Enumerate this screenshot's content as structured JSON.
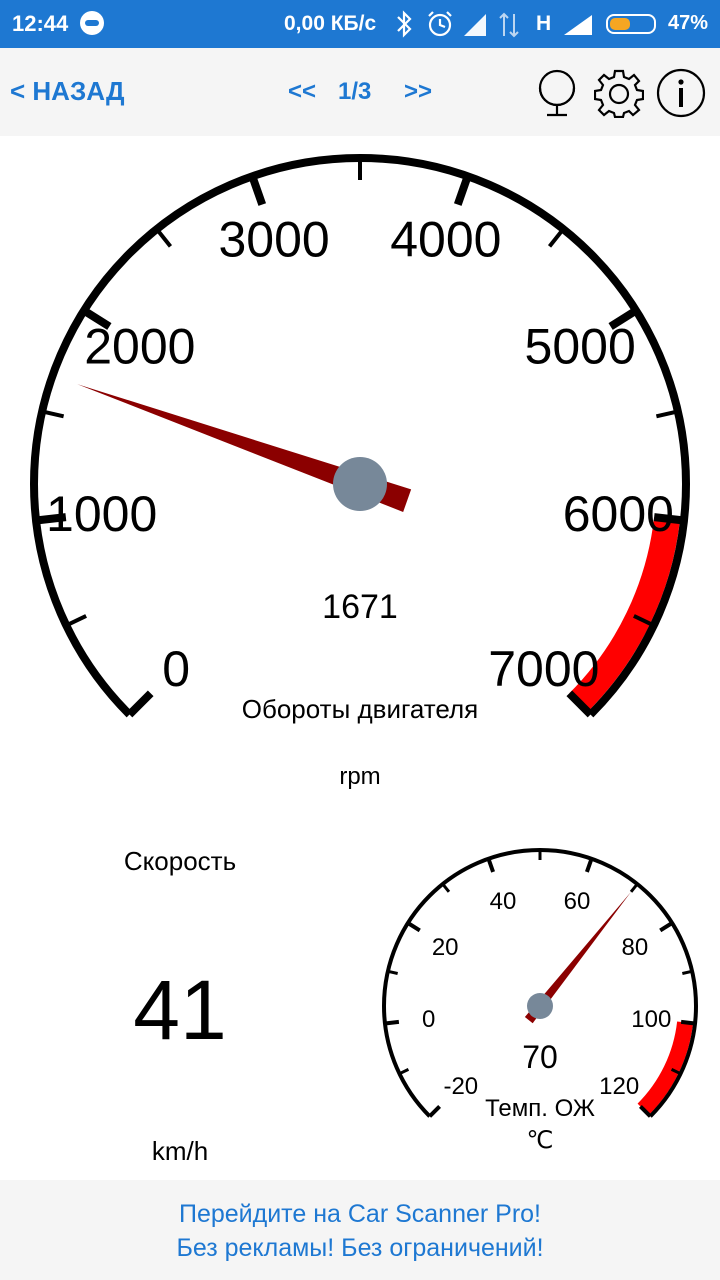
{
  "status_bar": {
    "time": "12:44",
    "app_icon": "car-scanner-icon",
    "net_speed": "0,00 КБ/с",
    "icons": [
      "bluetooth-icon",
      "alarm-icon",
      "signal-icon",
      "data-transfer-icon",
      "signal-icon"
    ],
    "network_type": "H",
    "battery_level": 0.47,
    "battery_pct": "47%"
  },
  "toolbar": {
    "back_label": "< НАЗАД",
    "prev_label": "<<",
    "page": "1/3",
    "next_label": ">>",
    "icons": [
      "globe-icon",
      "gear-icon",
      "info-icon"
    ]
  },
  "rpm_gauge": {
    "title": "Обороты двигателя",
    "unit": "rpm",
    "value": 1671,
    "value_text": "1671",
    "min": 0,
    "max": 7000,
    "labels": [
      "0",
      "1000",
      "2000",
      "3000",
      "4000",
      "5000",
      "6000",
      "7000"
    ],
    "redline_from": 6000,
    "colors": {
      "needle": "#8b0000",
      "redzone": "#ff0000",
      "hub": "#778899"
    }
  },
  "speed": {
    "label": "Скорость",
    "value": "41",
    "unit": "km/h"
  },
  "temp_gauge": {
    "title": "Темп. ОЖ",
    "unit": "℃",
    "value": 70,
    "value_text": "70",
    "min": -20,
    "max": 120,
    "labels": [
      "-20",
      "0",
      "20",
      "40",
      "60",
      "80",
      "100",
      "120"
    ],
    "redline_from": 100
  },
  "promo": {
    "line1": "Перейдите на Car Scanner Pro!",
    "line2": "Без рекламы! Без ограничений!"
  }
}
